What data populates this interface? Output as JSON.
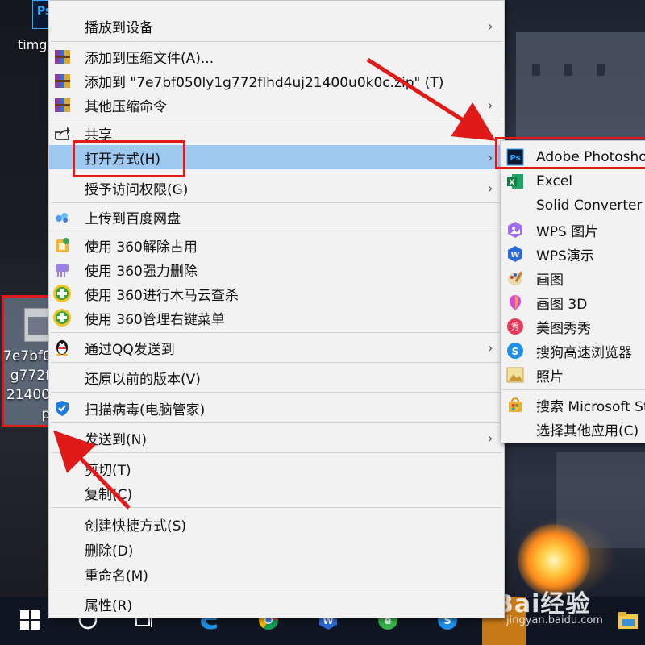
{
  "desktop": {
    "top_label": "timg",
    "ps_icon_text": "Ps",
    "selected_file_name_lines": [
      "7e7bf0",
      "g772f",
      "21400",
      "p"
    ]
  },
  "context_menu": {
    "items": [
      {
        "label": "播放到设备",
        "submenu": true
      },
      {
        "label": "添加到压缩文件(A)...",
        "submenu": false
      },
      {
        "label": "添加到 \"7e7bf050ly1g772flhd4uj21400u0k0c.zip\" (T)",
        "submenu": false
      },
      {
        "label": "其他压缩命令",
        "submenu": true
      },
      {
        "label": "共享",
        "submenu": false
      },
      {
        "label": "打开方式(H)",
        "submenu": true
      },
      {
        "label": "授予访问权限(G)",
        "submenu": true
      },
      {
        "label": "上传到百度网盘",
        "submenu": false
      },
      {
        "label": "使用 360解除占用",
        "submenu": false
      },
      {
        "label": "使用 360强力删除",
        "submenu": false
      },
      {
        "label": "使用 360进行木马云查杀",
        "submenu": false
      },
      {
        "label": "使用 360管理右键菜单",
        "submenu": false
      },
      {
        "label": "通过QQ发送到",
        "submenu": true
      },
      {
        "label": "还原以前的版本(V)",
        "submenu": false
      },
      {
        "label": "扫描病毒(电脑管家)",
        "submenu": false
      },
      {
        "label": "发送到(N)",
        "submenu": true
      },
      {
        "label": "剪切(T)",
        "submenu": false
      },
      {
        "label": "复制(C)",
        "submenu": false
      },
      {
        "label": "创建快捷方式(S)",
        "submenu": false
      },
      {
        "label": "删除(D)",
        "submenu": false
      },
      {
        "label": "重命名(M)",
        "submenu": false
      },
      {
        "label": "属性(R)",
        "submenu": false
      }
    ],
    "arrow_glyph": "›"
  },
  "open_with_submenu": {
    "items": [
      {
        "label": "Adobe Photoshop"
      },
      {
        "label": "Excel"
      },
      {
        "label": "Solid Converter"
      },
      {
        "label": "WPS 图片"
      },
      {
        "label": "WPS演示"
      },
      {
        "label": "画图"
      },
      {
        "label": "画图 3D"
      },
      {
        "label": "美图秀秀"
      },
      {
        "label": "搜狗高速浏览器"
      },
      {
        "label": "照片"
      },
      {
        "label": "搜索 Microsoft Store"
      },
      {
        "label": "选择其他应用(C)"
      }
    ]
  },
  "watermark": {
    "brand": "Bai经验",
    "url": "jingyan.baidu.com"
  },
  "colors": {
    "highlight": "#9fc8f0",
    "annotation_red": "#e01919",
    "menu_bg": "#f2f2f2"
  }
}
